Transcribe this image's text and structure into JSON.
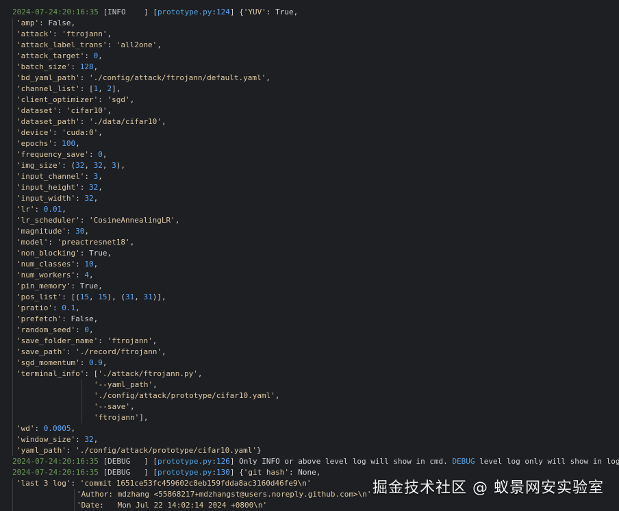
{
  "log_lines": [
    {
      "indent": 18,
      "guides": [],
      "segs": [
        {
          "t": "2024-07-24:20:16:35",
          "c": "ts"
        },
        {
          "t": " [INFO    ] [",
          "c": "lvl"
        },
        {
          "t": "prototype.py",
          "c": "file"
        },
        {
          "t": ":",
          "c": "pl"
        },
        {
          "t": "124",
          "c": "num"
        },
        {
          "t": "] {",
          "c": "pl"
        },
        {
          "t": "'YUV'",
          "c": "str"
        },
        {
          "t": ": True,",
          "c": "pl"
        }
      ]
    },
    {
      "indent": 24,
      "guides": [
        18
      ],
      "segs": [
        {
          "t": "'amp'",
          "c": "key"
        },
        {
          "t": ": False,",
          "c": "pl"
        }
      ]
    },
    {
      "indent": 24,
      "guides": [
        18
      ],
      "segs": [
        {
          "t": "'attack'",
          "c": "key"
        },
        {
          "t": ": ",
          "c": "pl"
        },
        {
          "t": "'ftrojann'",
          "c": "str"
        },
        {
          "t": ",",
          "c": "pl"
        }
      ]
    },
    {
      "indent": 24,
      "guides": [
        18
      ],
      "segs": [
        {
          "t": "'attack_label_trans'",
          "c": "key"
        },
        {
          "t": ": ",
          "c": "pl"
        },
        {
          "t": "'all2one'",
          "c": "str"
        },
        {
          "t": ",",
          "c": "pl"
        }
      ]
    },
    {
      "indent": 24,
      "guides": [
        18
      ],
      "segs": [
        {
          "t": "'attack_target'",
          "c": "key"
        },
        {
          "t": ": ",
          "c": "pl"
        },
        {
          "t": "0",
          "c": "num"
        },
        {
          "t": ",",
          "c": "pl"
        }
      ]
    },
    {
      "indent": 24,
      "guides": [
        18
      ],
      "segs": [
        {
          "t": "'batch_size'",
          "c": "key"
        },
        {
          "t": ": ",
          "c": "pl"
        },
        {
          "t": "128",
          "c": "num"
        },
        {
          "t": ",",
          "c": "pl"
        }
      ]
    },
    {
      "indent": 24,
      "guides": [
        18
      ],
      "segs": [
        {
          "t": "'bd_yaml_path'",
          "c": "key"
        },
        {
          "t": ": ",
          "c": "pl"
        },
        {
          "t": "'./config/attack/ftrojann/default.yaml'",
          "c": "str"
        },
        {
          "t": ",",
          "c": "pl"
        }
      ]
    },
    {
      "indent": 24,
      "guides": [
        18
      ],
      "segs": [
        {
          "t": "'channel_list'",
          "c": "key"
        },
        {
          "t": ": [",
          "c": "pl"
        },
        {
          "t": "1",
          "c": "num"
        },
        {
          "t": ", ",
          "c": "pl"
        },
        {
          "t": "2",
          "c": "num"
        },
        {
          "t": "],",
          "c": "pl"
        }
      ]
    },
    {
      "indent": 24,
      "guides": [
        18
      ],
      "segs": [
        {
          "t": "'client_optimizer'",
          "c": "key"
        },
        {
          "t": ": ",
          "c": "pl"
        },
        {
          "t": "'sgd'",
          "c": "str"
        },
        {
          "t": ",",
          "c": "pl"
        }
      ]
    },
    {
      "indent": 24,
      "guides": [
        18
      ],
      "segs": [
        {
          "t": "'dataset'",
          "c": "key"
        },
        {
          "t": ": ",
          "c": "pl"
        },
        {
          "t": "'cifar10'",
          "c": "str"
        },
        {
          "t": ",",
          "c": "pl"
        }
      ]
    },
    {
      "indent": 24,
      "guides": [
        18
      ],
      "segs": [
        {
          "t": "'dataset_path'",
          "c": "key"
        },
        {
          "t": ": ",
          "c": "pl"
        },
        {
          "t": "'./data/cifar10'",
          "c": "str"
        },
        {
          "t": ",",
          "c": "pl"
        }
      ]
    },
    {
      "indent": 24,
      "guides": [
        18
      ],
      "segs": [
        {
          "t": "'device'",
          "c": "key"
        },
        {
          "t": ": ",
          "c": "pl"
        },
        {
          "t": "'cuda:0'",
          "c": "str"
        },
        {
          "t": ",",
          "c": "pl"
        }
      ]
    },
    {
      "indent": 24,
      "guides": [
        18
      ],
      "segs": [
        {
          "t": "'epochs'",
          "c": "key"
        },
        {
          "t": ": ",
          "c": "pl"
        },
        {
          "t": "100",
          "c": "num"
        },
        {
          "t": ",",
          "c": "pl"
        }
      ]
    },
    {
      "indent": 24,
      "guides": [
        18
      ],
      "segs": [
        {
          "t": "'frequency_save'",
          "c": "key"
        },
        {
          "t": ": ",
          "c": "pl"
        },
        {
          "t": "0",
          "c": "num"
        },
        {
          "t": ",",
          "c": "pl"
        }
      ]
    },
    {
      "indent": 24,
      "guides": [
        18
      ],
      "segs": [
        {
          "t": "'img_size'",
          "c": "key"
        },
        {
          "t": ": (",
          "c": "pl"
        },
        {
          "t": "32",
          "c": "num"
        },
        {
          "t": ", ",
          "c": "pl"
        },
        {
          "t": "32",
          "c": "num"
        },
        {
          "t": ", ",
          "c": "pl"
        },
        {
          "t": "3",
          "c": "num"
        },
        {
          "t": "),",
          "c": "pl"
        }
      ]
    },
    {
      "indent": 24,
      "guides": [
        18
      ],
      "segs": [
        {
          "t": "'input_channel'",
          "c": "key"
        },
        {
          "t": ": ",
          "c": "pl"
        },
        {
          "t": "3",
          "c": "num"
        },
        {
          "t": ",",
          "c": "pl"
        }
      ]
    },
    {
      "indent": 24,
      "guides": [
        18
      ],
      "segs": [
        {
          "t": "'input_height'",
          "c": "key"
        },
        {
          "t": ": ",
          "c": "pl"
        },
        {
          "t": "32",
          "c": "num"
        },
        {
          "t": ",",
          "c": "pl"
        }
      ]
    },
    {
      "indent": 24,
      "guides": [
        18
      ],
      "segs": [
        {
          "t": "'input_width'",
          "c": "key"
        },
        {
          "t": ": ",
          "c": "pl"
        },
        {
          "t": "32",
          "c": "num"
        },
        {
          "t": ",",
          "c": "pl"
        }
      ]
    },
    {
      "indent": 24,
      "guides": [
        18
      ],
      "segs": [
        {
          "t": "'lr'",
          "c": "key"
        },
        {
          "t": ": ",
          "c": "pl"
        },
        {
          "t": "0.01",
          "c": "num"
        },
        {
          "t": ",",
          "c": "pl"
        }
      ]
    },
    {
      "indent": 24,
      "guides": [
        18
      ],
      "segs": [
        {
          "t": "'lr_scheduler'",
          "c": "key"
        },
        {
          "t": ": ",
          "c": "pl"
        },
        {
          "t": "'CosineAnnealingLR'",
          "c": "str"
        },
        {
          "t": ",",
          "c": "pl"
        }
      ]
    },
    {
      "indent": 24,
      "guides": [
        18
      ],
      "segs": [
        {
          "t": "'magnitude'",
          "c": "key"
        },
        {
          "t": ": ",
          "c": "pl"
        },
        {
          "t": "30",
          "c": "num"
        },
        {
          "t": ",",
          "c": "pl"
        }
      ]
    },
    {
      "indent": 24,
      "guides": [
        18
      ],
      "segs": [
        {
          "t": "'model'",
          "c": "key"
        },
        {
          "t": ": ",
          "c": "pl"
        },
        {
          "t": "'preactresnet18'",
          "c": "str"
        },
        {
          "t": ",",
          "c": "pl"
        }
      ]
    },
    {
      "indent": 24,
      "guides": [
        18
      ],
      "segs": [
        {
          "t": "'non_blocking'",
          "c": "key"
        },
        {
          "t": ": True,",
          "c": "pl"
        }
      ]
    },
    {
      "indent": 24,
      "guides": [
        18
      ],
      "segs": [
        {
          "t": "'num_classes'",
          "c": "key"
        },
        {
          "t": ": ",
          "c": "pl"
        },
        {
          "t": "10",
          "c": "num"
        },
        {
          "t": ",",
          "c": "pl"
        }
      ]
    },
    {
      "indent": 24,
      "guides": [
        18
      ],
      "segs": [
        {
          "t": "'num_workers'",
          "c": "key"
        },
        {
          "t": ": ",
          "c": "pl"
        },
        {
          "t": "4",
          "c": "num"
        },
        {
          "t": ",",
          "c": "pl"
        }
      ]
    },
    {
      "indent": 24,
      "guides": [
        18
      ],
      "segs": [
        {
          "t": "'pin_memory'",
          "c": "key"
        },
        {
          "t": ": True,",
          "c": "pl"
        }
      ]
    },
    {
      "indent": 24,
      "guides": [
        18
      ],
      "segs": [
        {
          "t": "'pos_list'",
          "c": "key"
        },
        {
          "t": ": [(",
          "c": "pl"
        },
        {
          "t": "15",
          "c": "num"
        },
        {
          "t": ", ",
          "c": "pl"
        },
        {
          "t": "15",
          "c": "num"
        },
        {
          "t": "), (",
          "c": "pl"
        },
        {
          "t": "31",
          "c": "num"
        },
        {
          "t": ", ",
          "c": "pl"
        },
        {
          "t": "31",
          "c": "num"
        },
        {
          "t": ")],",
          "c": "pl"
        }
      ]
    },
    {
      "indent": 24,
      "guides": [
        18
      ],
      "segs": [
        {
          "t": "'pratio'",
          "c": "key"
        },
        {
          "t": ": ",
          "c": "pl"
        },
        {
          "t": "0.1",
          "c": "num"
        },
        {
          "t": ",",
          "c": "pl"
        }
      ]
    },
    {
      "indent": 24,
      "guides": [
        18
      ],
      "segs": [
        {
          "t": "'prefetch'",
          "c": "key"
        },
        {
          "t": ": False,",
          "c": "pl"
        }
      ]
    },
    {
      "indent": 24,
      "guides": [
        18
      ],
      "segs": [
        {
          "t": "'random_seed'",
          "c": "key"
        },
        {
          "t": ": ",
          "c": "pl"
        },
        {
          "t": "0",
          "c": "num"
        },
        {
          "t": ",",
          "c": "pl"
        }
      ]
    },
    {
      "indent": 24,
      "guides": [
        18
      ],
      "segs": [
        {
          "t": "'save_folder_name'",
          "c": "key"
        },
        {
          "t": ": ",
          "c": "pl"
        },
        {
          "t": "'ftrojann'",
          "c": "str"
        },
        {
          "t": ",",
          "c": "pl"
        }
      ]
    },
    {
      "indent": 24,
      "guides": [
        18
      ],
      "segs": [
        {
          "t": "'save_path'",
          "c": "key"
        },
        {
          "t": ": ",
          "c": "pl"
        },
        {
          "t": "'./record/ftrojann'",
          "c": "str"
        },
        {
          "t": ",",
          "c": "pl"
        }
      ]
    },
    {
      "indent": 24,
      "guides": [
        18
      ],
      "segs": [
        {
          "t": "'sgd_momentum'",
          "c": "key"
        },
        {
          "t": ": ",
          "c": "pl"
        },
        {
          "t": "0.9",
          "c": "num"
        },
        {
          "t": ",",
          "c": "pl"
        }
      ]
    },
    {
      "indent": 24,
      "guides": [
        18
      ],
      "segs": [
        {
          "t": "'terminal_info'",
          "c": "key"
        },
        {
          "t": ": [",
          "c": "pl"
        },
        {
          "t": "'./attack/ftrojann.py'",
          "c": "str"
        },
        {
          "t": ",",
          "c": "pl"
        }
      ]
    },
    {
      "indent": 137,
      "guides": [
        18,
        119
      ],
      "segs": [
        {
          "t": "'--yaml_path'",
          "c": "str"
        },
        {
          "t": ",",
          "c": "pl"
        }
      ]
    },
    {
      "indent": 137,
      "guides": [
        18,
        119
      ],
      "segs": [
        {
          "t": "'./config/attack/prototype/cifar10.yaml'",
          "c": "str"
        },
        {
          "t": ",",
          "c": "pl"
        }
      ]
    },
    {
      "indent": 137,
      "guides": [
        18,
        119
      ],
      "segs": [
        {
          "t": "'--save'",
          "c": "str"
        },
        {
          "t": ",",
          "c": "pl"
        }
      ]
    },
    {
      "indent": 137,
      "guides": [
        18,
        119
      ],
      "segs": [
        {
          "t": "'ftrojann'",
          "c": "str"
        },
        {
          "t": "],",
          "c": "pl"
        }
      ]
    },
    {
      "indent": 24,
      "guides": [
        18
      ],
      "segs": [
        {
          "t": "'wd'",
          "c": "key"
        },
        {
          "t": ": ",
          "c": "pl"
        },
        {
          "t": "0.0005",
          "c": "num"
        },
        {
          "t": ",",
          "c": "pl"
        }
      ]
    },
    {
      "indent": 24,
      "guides": [
        18
      ],
      "segs": [
        {
          "t": "'window_size'",
          "c": "key"
        },
        {
          "t": ": ",
          "c": "pl"
        },
        {
          "t": "32",
          "c": "num"
        },
        {
          "t": ",",
          "c": "pl"
        }
      ]
    },
    {
      "indent": 24,
      "guides": [
        18
      ],
      "segs": [
        {
          "t": "'yaml_path'",
          "c": "key"
        },
        {
          "t": ": ",
          "c": "pl"
        },
        {
          "t": "'./config/attack/prototype/cifar10.yaml'",
          "c": "str"
        },
        {
          "t": "}",
          "c": "pl"
        }
      ]
    },
    {
      "indent": 18,
      "guides": [],
      "segs": [
        {
          "t": "2024-07-24:20:16:35",
          "c": "ts"
        },
        {
          "t": " [DEBUG   ] [",
          "c": "lvl"
        },
        {
          "t": "prototype.py",
          "c": "file"
        },
        {
          "t": ":",
          "c": "pl"
        },
        {
          "t": "126",
          "c": "num"
        },
        {
          "t": "] Only INFO or above level log will show in cmd. ",
          "c": "pl"
        },
        {
          "t": "DEBUG",
          "c": "dbgword"
        },
        {
          "t": " level log only will show in log file.",
          "c": "pl"
        }
      ]
    },
    {
      "indent": 18,
      "guides": [],
      "segs": [
        {
          "t": "2024-07-24:20:16:35",
          "c": "ts"
        },
        {
          "t": " [DEBUG   ] [",
          "c": "lvl"
        },
        {
          "t": "prototype.py",
          "c": "file"
        },
        {
          "t": ":",
          "c": "pl"
        },
        {
          "t": "130",
          "c": "num"
        },
        {
          "t": "] {",
          "c": "pl"
        },
        {
          "t": "'git hash'",
          "c": "str"
        },
        {
          "t": ": None,",
          "c": "pl"
        }
      ]
    },
    {
      "indent": 24,
      "guides": [
        18
      ],
      "segs": [
        {
          "t": "'last 3 log'",
          "c": "key"
        },
        {
          "t": ": ",
          "c": "pl"
        },
        {
          "t": "'commit 1651ce53fc459602c8eb159fdda8ac3160d46fe9\\n'",
          "c": "str"
        }
      ]
    },
    {
      "indent": 112,
      "guides": [
        18,
        108
      ],
      "segs": [
        {
          "t": "'Author: mdzhang <55868217+mdzhangst@users.noreply.github.com>\\n'",
          "c": "str"
        }
      ]
    },
    {
      "indent": 112,
      "guides": [
        18,
        108
      ],
      "segs": [
        {
          "t": "'Date:   Mon Jul 22 14:02:14 2024 +0800\\n'",
          "c": "str"
        }
      ]
    }
  ],
  "watermark": "掘金技术社区 @ 蚁景网安实验室"
}
